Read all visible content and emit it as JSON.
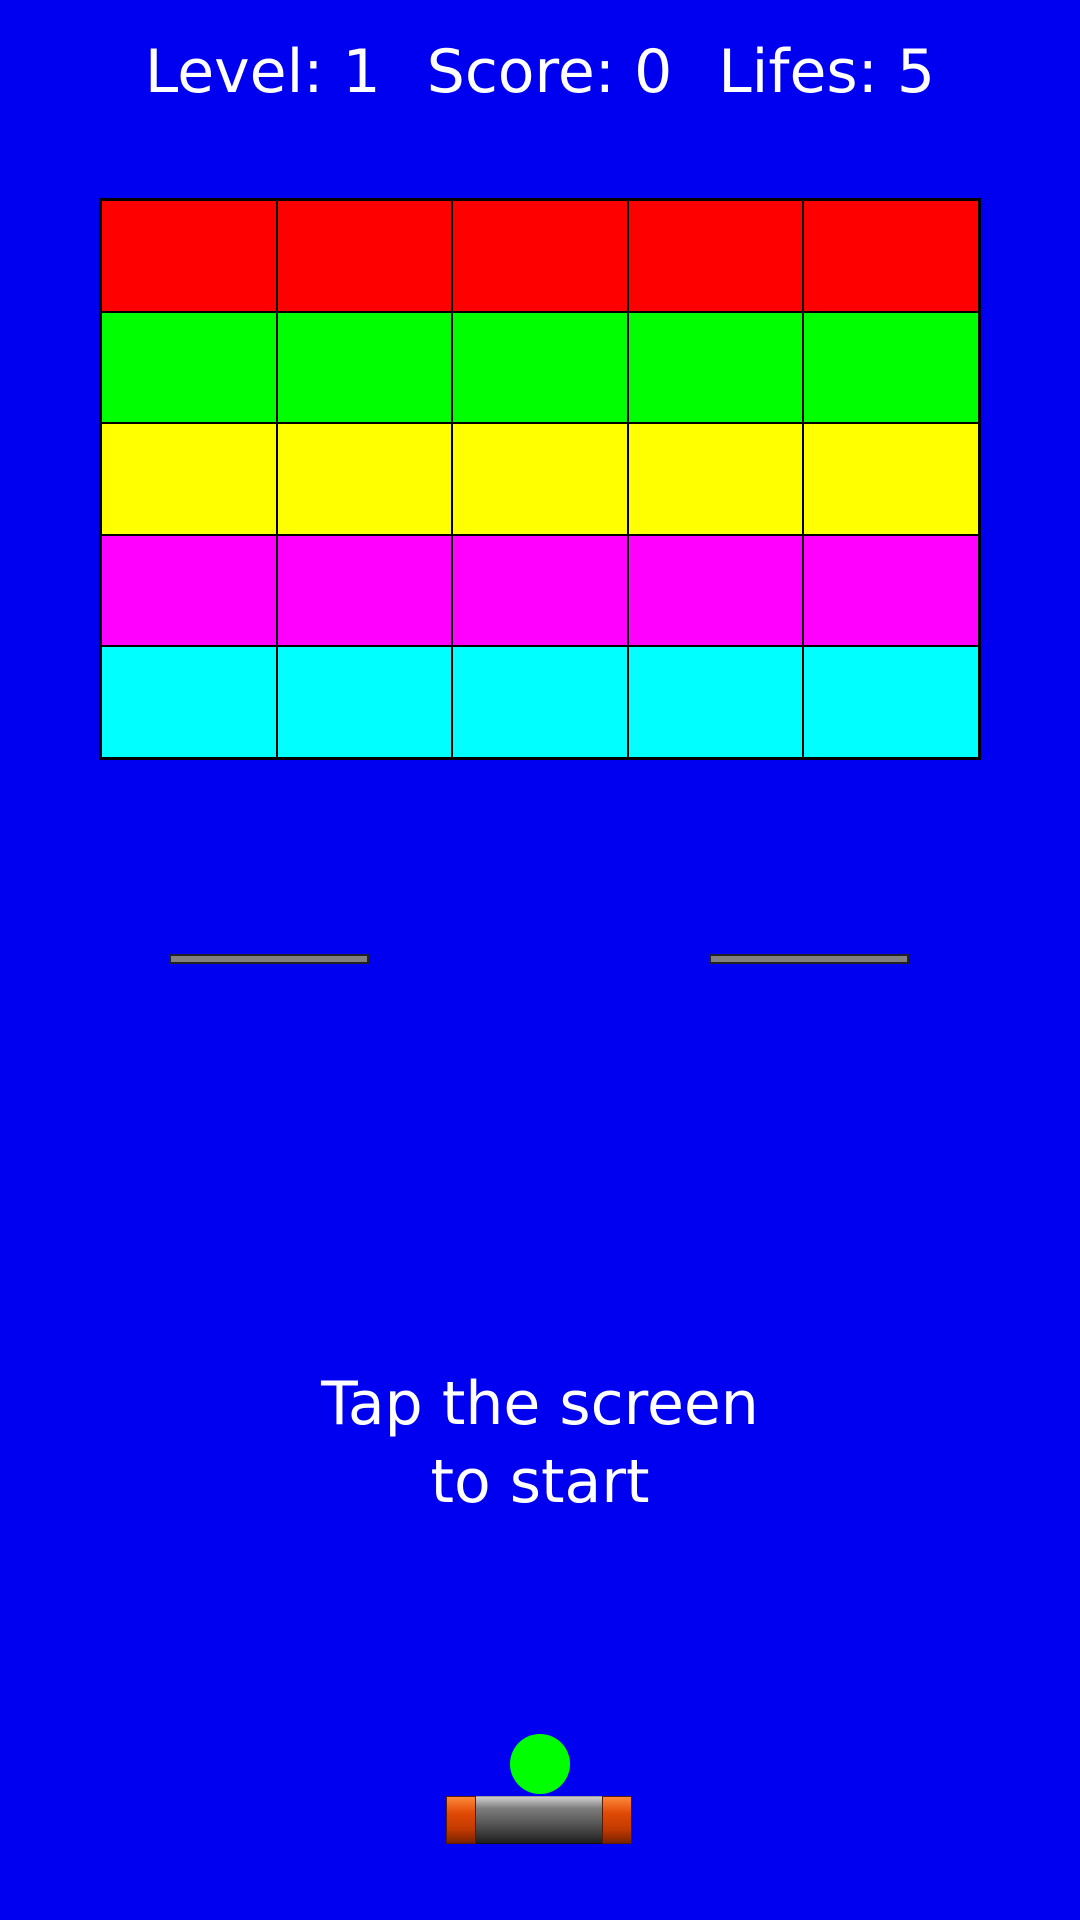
{
  "hud": {
    "level_label": "Level: 1",
    "score_label": "Score: 0",
    "lifes_label": "Lifes: 5",
    "level": 1,
    "score": 0,
    "lifes": 5
  },
  "colors": {
    "background": "#0000F0",
    "text": "#FFFFFF",
    "ball": "#00FF00",
    "barrier": "#808080",
    "brick_border": "#000000"
  },
  "bricks": {
    "rows": [
      {
        "color": "#FF0000",
        "count": 5
      },
      {
        "color": "#00FF00",
        "count": 5
      },
      {
        "color": "#FFFF00",
        "count": 5
      },
      {
        "color": "#FF00FF",
        "count": 5
      },
      {
        "color": "#00FFFF",
        "count": 5
      }
    ]
  },
  "prompt": {
    "line1": "Tap the screen",
    "line2": "to start"
  }
}
